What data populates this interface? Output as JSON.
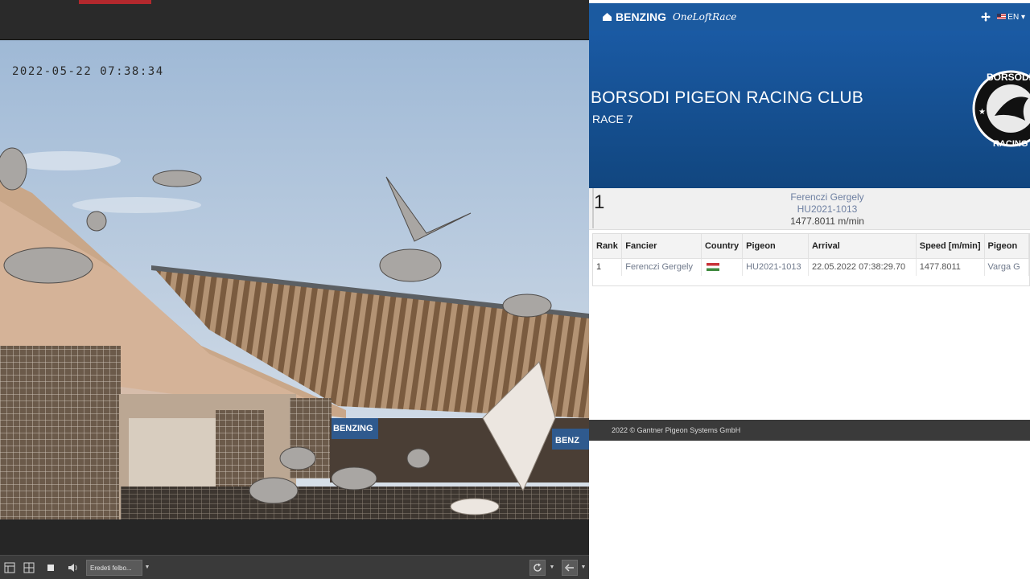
{
  "viewer": {
    "timestamp": "2022-05-22 07:38:34",
    "stream_select": "Eredeti felbo...",
    "sign_text": "BENZING",
    "sign_text_2": "BENZ",
    "toolbar_icons": [
      "layout-grid-icon",
      "layout-quad-icon",
      "stop-icon",
      "speaker-icon",
      "refresh-icon",
      "arrow-left-icon"
    ]
  },
  "web": {
    "brand": "BENZING",
    "brand_script": "OneLoftRace",
    "language": "EN",
    "club_name": "BORSODI PIGEON RACING CLUB",
    "race_name": "RACE 7",
    "logo_text_top": "BORSODI",
    "logo_text_bottom": "RACING",
    "winner": {
      "rank": "1",
      "fancier": "Ferenczi Gergely",
      "ring": "HU2021-1013",
      "speed": "1477.8011 m/min"
    },
    "table": {
      "headers": [
        "Rank",
        "Fancier",
        "Country",
        "Pigeon",
        "Arrival",
        "Speed [m/min]",
        "Pigeon"
      ],
      "rows": [
        {
          "rank": "1",
          "fancier": "Ferenczi Gergely",
          "country_flag": "HU",
          "pigeon": "HU2021-1013",
          "arrival": "22.05.2022 07:38:29.70",
          "speed": "1477.8011",
          "pigeon_name": "Varga G"
        }
      ]
    },
    "footer": "2022 © Gantner Pigeon Systems GmbH",
    "colors": {
      "navbar": "#1b5aa0",
      "hero": "#11467f",
      "footer": "#3a3a3a"
    }
  }
}
